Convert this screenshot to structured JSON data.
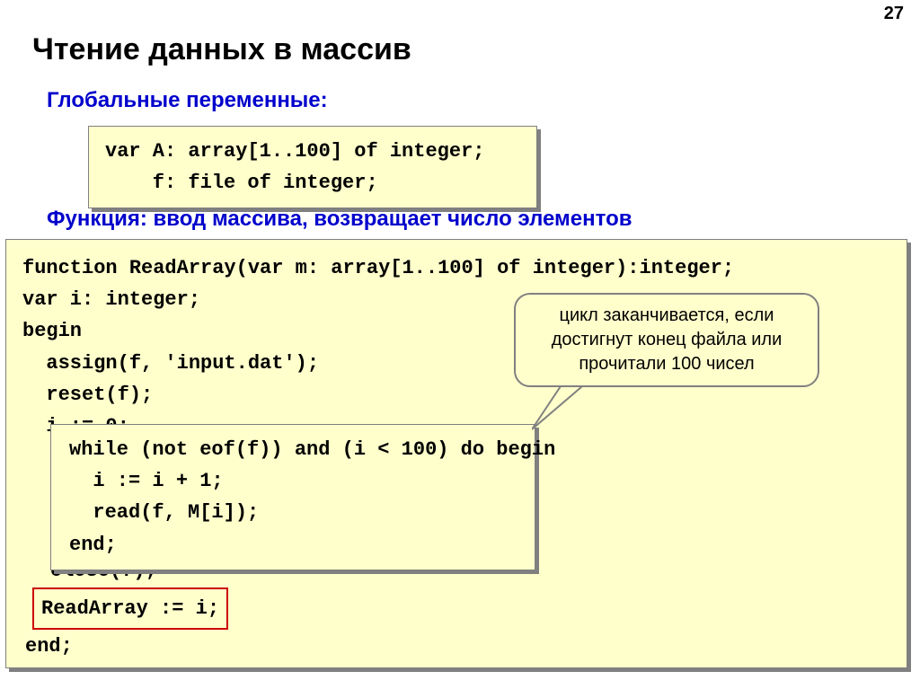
{
  "page_number": "27",
  "title": "Чтение данных в массив",
  "subtitle_globals": "Глобальные переменные:",
  "code_globals": "var A: array[1..100] of integer;\n    f: file of integer;",
  "subtitle_function": "Функция: ввод массива, возвращает число элементов",
  "code_main_top": "function ReadArray(var m: array[1..100] of integer):integer;\nvar i: integer;\nbegin\n  assign(f, 'input.dat');\n  reset(f);\n  i := 0;",
  "code_inner": "while (not eof(f)) and (i < 100) do begin\n  i := i + 1;\n  read(f, M[i]);\nend;",
  "code_close": "close(f);",
  "code_result": "ReadArray := i;",
  "code_end": "end;",
  "callout_text": "цикл заканчивается, если достигнут конец файла или прочитали 100 чисел"
}
